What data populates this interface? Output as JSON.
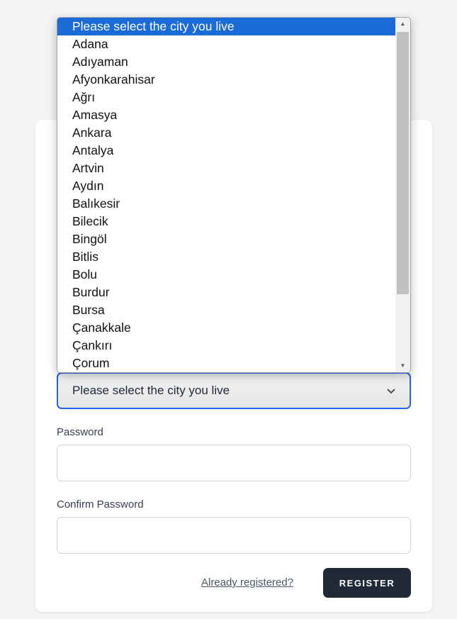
{
  "city_select": {
    "selected": "Please select the city you live",
    "options": [
      "Please select the city you live",
      "Adana",
      "Adıyaman",
      "Afyonkarahisar",
      "Ağrı",
      "Amasya",
      "Ankara",
      "Antalya",
      "Artvin",
      "Aydın",
      "Balıkesir",
      "Bilecik",
      "Bingöl",
      "Bitlis",
      "Bolu",
      "Burdur",
      "Bursa",
      "Çanakkale",
      "Çankırı",
      "Çorum"
    ]
  },
  "password": {
    "label": "Password",
    "value": ""
  },
  "confirm_password": {
    "label": "Confirm Password",
    "value": ""
  },
  "login_link": "Already registered?",
  "register_button": "REGISTER",
  "colors": {
    "accent": "#2563eb",
    "button": "#1f2937",
    "highlight": "#1a6bd8"
  }
}
